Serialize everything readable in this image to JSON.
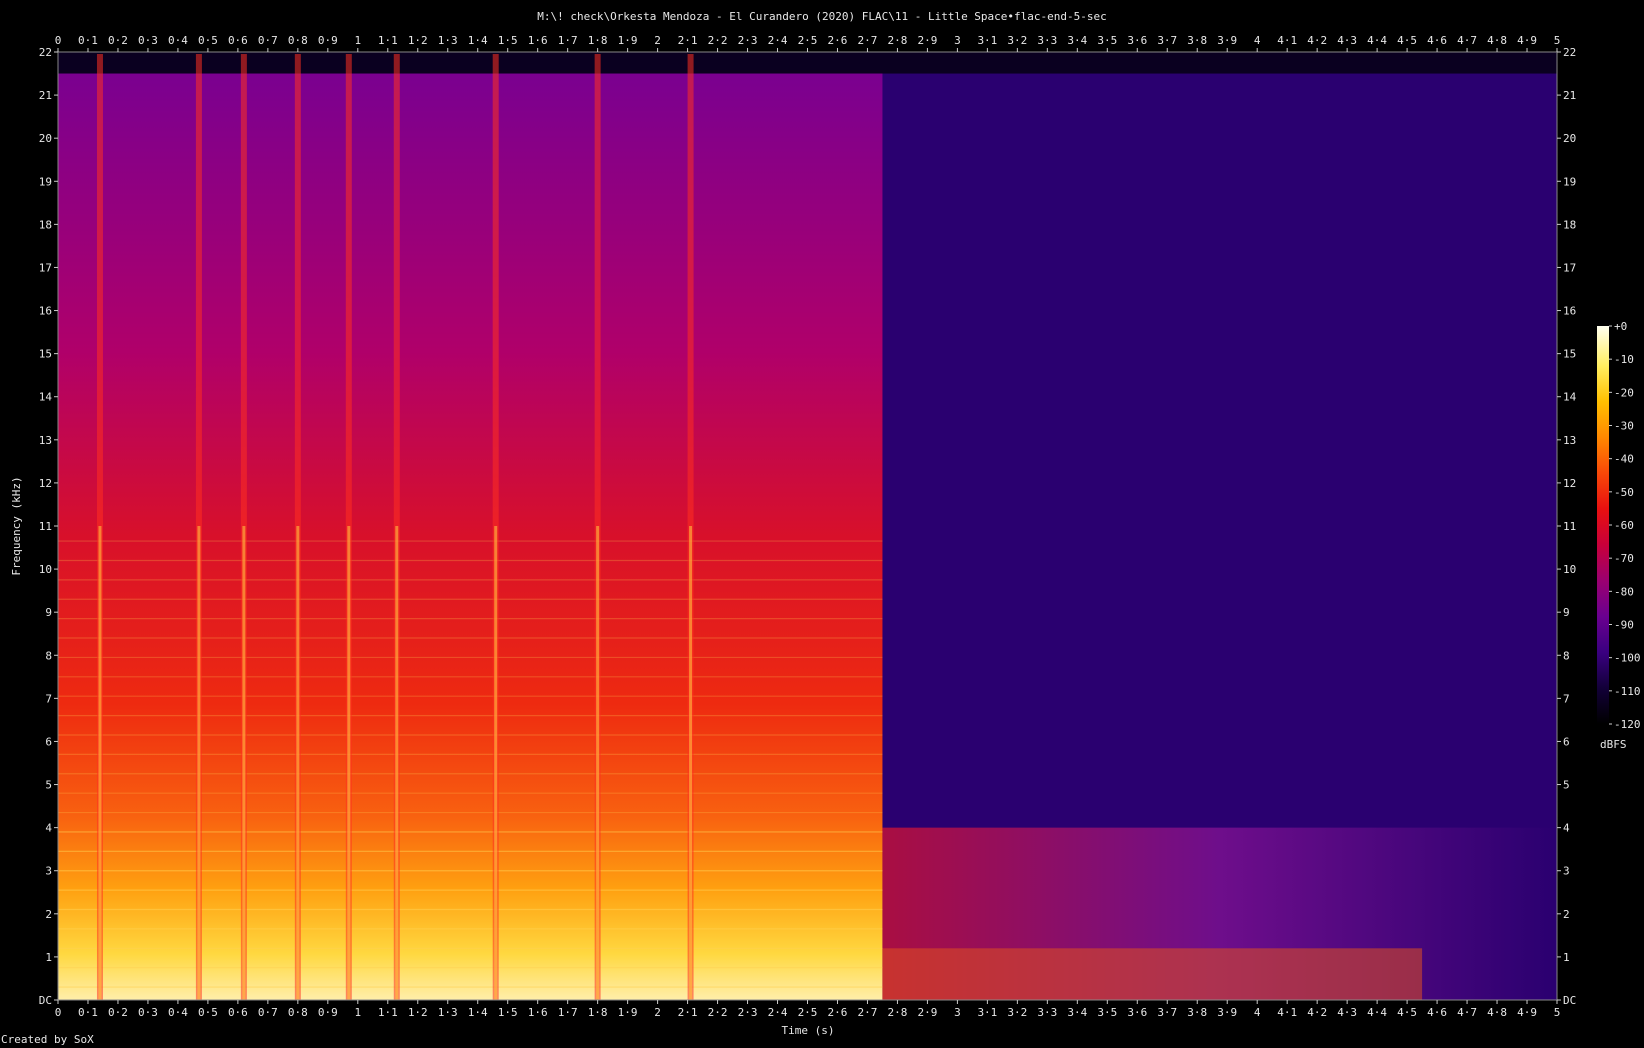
{
  "chart_data": {
    "type": "heatmap",
    "title": "M:\\! check\\Orkesta Mendoza - El Curandero (2020) FLAC\\11 - Little Space•flac-end-5-sec",
    "xlabel": "Time (s)",
    "ylabel": "Frequency (kHz)",
    "xlim": [
      0,
      5
    ],
    "ylim": [
      0,
      22
    ],
    "x_ticks": [
      "0",
      "0·1",
      "0·2",
      "0·3",
      "0·4",
      "0·5",
      "0·6",
      "0·7",
      "0·8",
      "0·9",
      "1",
      "1·1",
      "1·2",
      "1·3",
      "1·4",
      "1·5",
      "1·6",
      "1·7",
      "1·8",
      "1·9",
      "2",
      "2·1",
      "2·2",
      "2·3",
      "2·4",
      "2·5",
      "2·6",
      "2·7",
      "2·8",
      "2·9",
      "3",
      "3·1",
      "3·2",
      "3·3",
      "3·4",
      "3·5",
      "3·6",
      "3·7",
      "3·8",
      "3·9",
      "4",
      "4·1",
      "4·2",
      "4·3",
      "4·4",
      "4·5",
      "4·6",
      "4·7",
      "4·8",
      "4·9",
      "5"
    ],
    "y_ticks": [
      "DC",
      "1",
      "2",
      "3",
      "4",
      "5",
      "6",
      "7",
      "8",
      "9",
      "10",
      "11",
      "12",
      "13",
      "14",
      "15",
      "16",
      "17",
      "18",
      "19",
      "20",
      "21",
      "22"
    ],
    "colorbar": {
      "label": "dBFS",
      "ticks": [
        "+0",
        "-10",
        "-20",
        "-30",
        "-40",
        "-50",
        "-60",
        "-70",
        "-80",
        "-90",
        "-100",
        "-110",
        "-120"
      ],
      "range": [
        -120,
        0
      ],
      "colors": [
        "#000000",
        "#120038",
        "#3a0080",
        "#6a0090",
        "#9a0070",
        "#c8003a",
        "#e81010",
        "#f84808",
        "#ff8800",
        "#ffc000",
        "#ffee60",
        "#fffff0"
      ]
    },
    "sound_ends_at_s": 2.75,
    "transients_s": [
      0.14,
      0.47,
      0.62,
      0.8,
      0.97,
      1.13,
      1.46,
      1.8,
      2.11
    ],
    "high_freq_cutoff_khz": 21.5,
    "grid": false,
    "credit": "Created by SoX"
  }
}
